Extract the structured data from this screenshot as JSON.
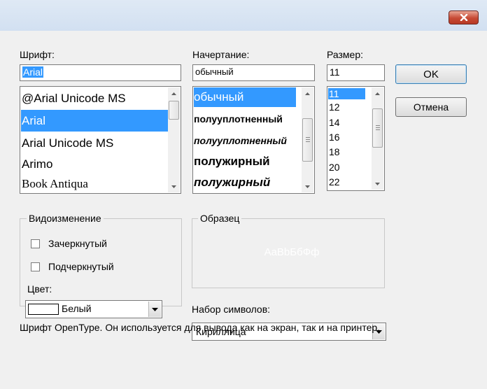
{
  "font": {
    "label": "Шрифт:",
    "value": "Arial",
    "items": [
      "@Arial Unicode MS",
      "Arial",
      "Arial Unicode MS",
      "Arimo",
      "Book Antiqua"
    ],
    "selected_index": 1
  },
  "style": {
    "label": "Начертание:",
    "value": "обычный",
    "items": [
      "обычный",
      "полууплотненный",
      "полууплотненный",
      "полужирный",
      "полужирный"
    ],
    "selected_index": 0
  },
  "size": {
    "label": "Размер:",
    "value": "11",
    "items": [
      "11",
      "12",
      "14",
      "16",
      "18",
      "20",
      "22"
    ],
    "selected_index": 0
  },
  "buttons": {
    "ok": "OK",
    "cancel": "Отмена"
  },
  "effects": {
    "title": "Видоизменение",
    "strikeout_label": "Зачеркнутый",
    "strikeout_checked": false,
    "underline_label": "Подчеркнутый",
    "underline_checked": false,
    "color_label": "Цвет:",
    "color_value": "Белый",
    "color_swatch": "#ffffff"
  },
  "sample": {
    "title": "Образец",
    "text": "AaBbБбФф"
  },
  "charset": {
    "label": "Набор символов:",
    "value": "Кириллица"
  },
  "description": "Шрифт OpenType. Он используется для вывода как на экран, так и на принтер.",
  "colors": {
    "selection": "#3399ff",
    "dialog_bg": "#f0f0f0",
    "close_button": "#c74a35"
  }
}
